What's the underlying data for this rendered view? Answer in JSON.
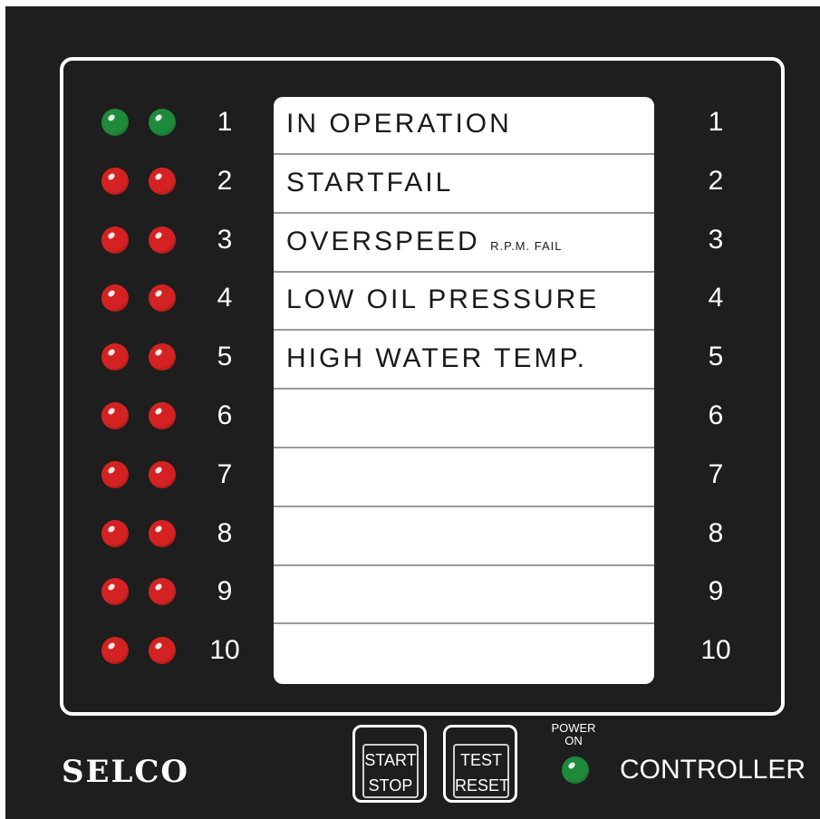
{
  "brand": "SELCO",
  "product": "CONTROLLER",
  "power_indicator": {
    "label_line1": "POWER",
    "label_line2": "ON",
    "color": "#1e8a3a"
  },
  "buttons": {
    "start_stop": {
      "line1": "START",
      "line2": "STOP"
    },
    "test_reset": {
      "line1": "TEST",
      "line2": "RESET"
    }
  },
  "led_colors": {
    "green": "#1e8a3a",
    "red": "#d42222"
  },
  "rows": [
    {
      "number": "1",
      "label": "IN OPERATION",
      "sub": "",
      "led_color": "green"
    },
    {
      "number": "2",
      "label": "STARTFAIL",
      "sub": "",
      "led_color": "red"
    },
    {
      "number": "3",
      "label": "OVERSPEED",
      "sub": "R.P.M. FAIL",
      "led_color": "red"
    },
    {
      "number": "4",
      "label": "LOW OIL PRESSURE",
      "sub": "",
      "led_color": "red"
    },
    {
      "number": "5",
      "label": "HIGH WATER TEMP.",
      "sub": "",
      "led_color": "red"
    },
    {
      "number": "6",
      "label": "",
      "sub": "",
      "led_color": "red"
    },
    {
      "number": "7",
      "label": "",
      "sub": "",
      "led_color": "red"
    },
    {
      "number": "8",
      "label": "",
      "sub": "",
      "led_color": "red"
    },
    {
      "number": "9",
      "label": "",
      "sub": "",
      "led_color": "red"
    },
    {
      "number": "10",
      "label": "",
      "sub": "",
      "led_color": "red"
    }
  ]
}
